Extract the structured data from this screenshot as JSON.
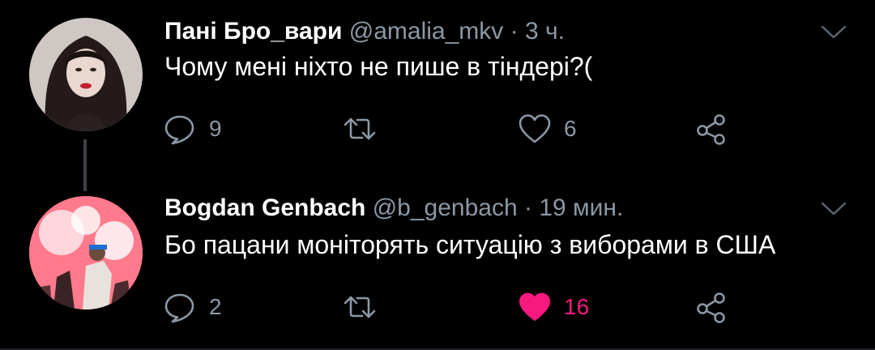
{
  "colors": {
    "background": "#000000",
    "text": "#ffffff",
    "secondary": "#8b98a5",
    "like_active": "#f91880"
  },
  "tweets": [
    {
      "name": "Пані Бро_вари",
      "handle": "@amalia_mkv",
      "separator": "·",
      "time": "3 ч.",
      "text": "Чому мені ніхто не пише в тіндері?(",
      "replies": "9",
      "retweets": "",
      "likes": "6",
      "liked": false,
      "avatar_icon": "profile-photo-woman"
    },
    {
      "name": "Bogdan Genbach",
      "handle": "@b_genbach",
      "separator": "·",
      "time": "19 мин.",
      "text": "Бо пацани моніторять ситуацію з виборами в США",
      "replies": "2",
      "retweets": "",
      "likes": "16",
      "liked": true,
      "avatar_icon": "profile-photo-flares-crowd"
    }
  ]
}
